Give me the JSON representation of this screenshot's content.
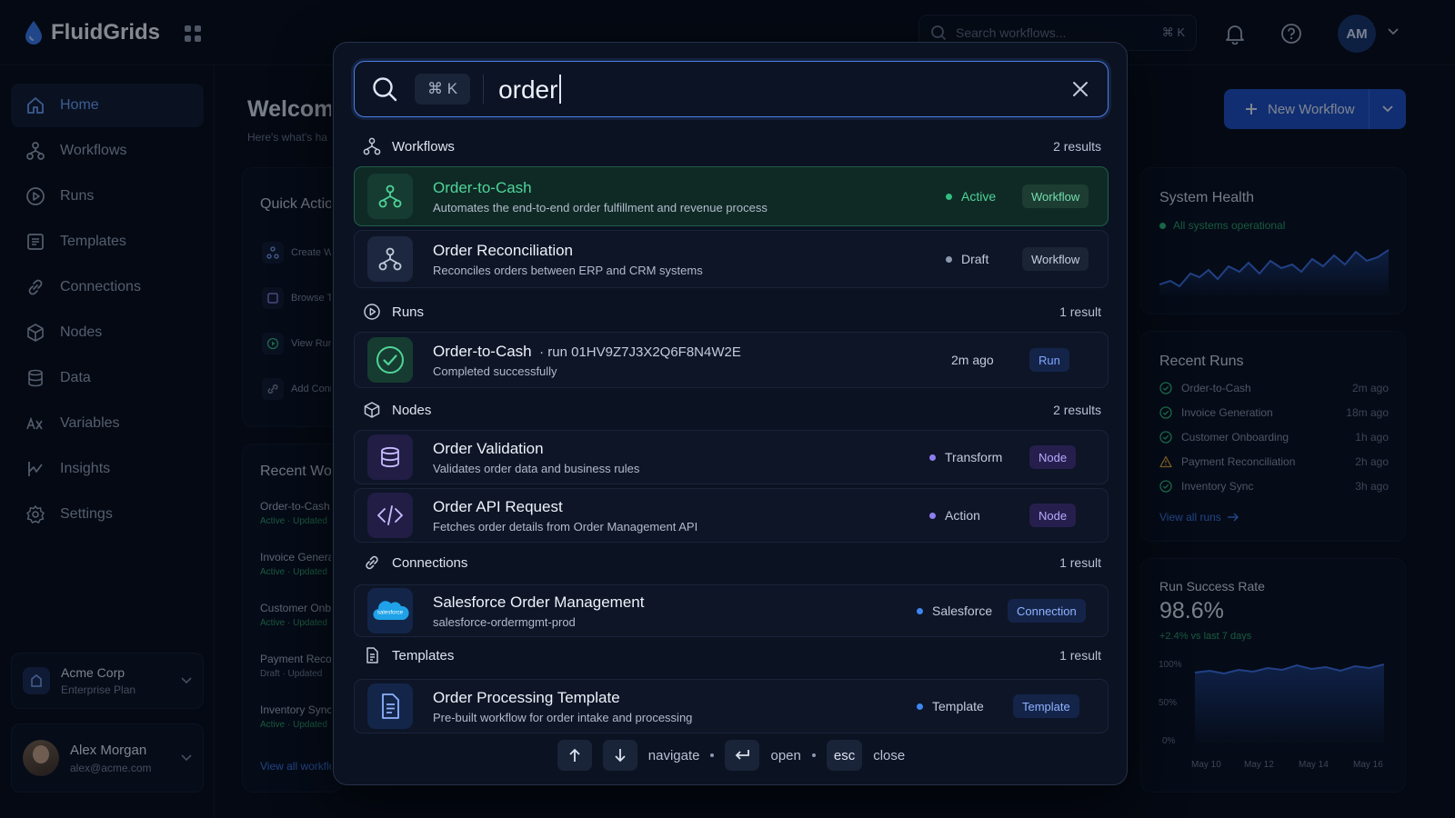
{
  "app": {
    "name": "FluidGrids"
  },
  "topbar": {
    "search_placeholder": "Search workflows...",
    "search_shortcut": "⌘ K",
    "avatar_initials": "AM"
  },
  "sidebar": {
    "items": [
      {
        "label": "Home",
        "icon": "home-icon",
        "active": true
      },
      {
        "label": "Workflows",
        "icon": "workflow-icon"
      },
      {
        "label": "Runs",
        "icon": "play-circle-icon"
      },
      {
        "label": "Templates",
        "icon": "template-icon"
      },
      {
        "label": "Connections",
        "icon": "link-icon"
      },
      {
        "label": "Nodes",
        "icon": "cube-icon"
      },
      {
        "label": "Data",
        "icon": "database-icon"
      },
      {
        "label": "Variables",
        "icon": "variable-icon"
      },
      {
        "label": "Insights",
        "icon": "insights-icon"
      },
      {
        "label": "Settings",
        "icon": "gear-icon"
      }
    ],
    "org": {
      "name": "Acme Corp",
      "plan": "Enterprise Plan"
    },
    "user": {
      "name": "Alex Morgan",
      "email": "alex@acme.com"
    }
  },
  "main": {
    "welcome": "Welcome",
    "welcome_sub": "Here's what's ha",
    "quick_actions": {
      "title": "Quick Actions",
      "items": [
        "Create Wo",
        "Browse Te",
        "View Runs",
        "Add Conn"
      ]
    },
    "recent_workflows": {
      "title": "Recent Wo",
      "items": [
        {
          "name": "Order-to-Cash",
          "meta": "Active · Updated"
        },
        {
          "name": "Invoice Generat",
          "meta": "Active · Updated"
        },
        {
          "name": "Customer Onbo",
          "meta": "Active · Updated"
        },
        {
          "name": "Payment Recon",
          "meta": "Draft · Updated"
        },
        {
          "name": "Inventory Sync",
          "meta": "Active · Updated"
        }
      ],
      "view_all": "View all workflows"
    },
    "new_workflow_label": "New Workflow"
  },
  "right_panel": {
    "system_health": {
      "title": "System Health",
      "status": "All systems operational"
    },
    "recent_runs": {
      "title": "Recent Runs",
      "items": [
        {
          "name": "Order-to-Cash",
          "time": "2m ago",
          "status": "success"
        },
        {
          "name": "Invoice Generation",
          "time": "18m ago",
          "status": "success"
        },
        {
          "name": "Customer Onboarding",
          "time": "1h ago",
          "status": "success"
        },
        {
          "name": "Payment Reconciliation",
          "time": "2h ago",
          "status": "warning"
        },
        {
          "name": "Inventory Sync",
          "time": "3h ago",
          "status": "success"
        }
      ],
      "view_all": "View all runs"
    },
    "run_success": {
      "title": "Run Success Rate",
      "value": "98.6%",
      "delta": "+2.4% vs last 7 days",
      "y_ticks": [
        "100%",
        "50%",
        "0%"
      ],
      "x_ticks": [
        "May 10",
        "May 12",
        "May 14",
        "May 16"
      ]
    }
  },
  "palette": {
    "shortcut": "⌘ K",
    "query": "order",
    "sections": {
      "workflows": {
        "label": "Workflows",
        "count": "2 results"
      },
      "runs": {
        "label": "Runs",
        "count": "1 result"
      },
      "nodes": {
        "label": "Nodes",
        "count": "2 results"
      },
      "connections": {
        "label": "Connections",
        "count": "1 result"
      },
      "templates": {
        "label": "Templates",
        "count": "1 result"
      }
    },
    "results": {
      "wf1": {
        "title": "Order-to-Cash",
        "desc": "Automates the end-to-end order fulfillment and revenue process",
        "status": "Active",
        "tag": "Workflow"
      },
      "wf2": {
        "title": "Order Reconciliation",
        "desc": "Reconciles orders between ERP and CRM systems",
        "status": "Draft",
        "tag": "Workflow"
      },
      "run1": {
        "title": "Order-to-Cash",
        "run_id": "· run 01HV9Z7J3X2Q6F8N4W2E",
        "desc": "Completed successfully",
        "time": "2m ago",
        "tag": "Run"
      },
      "node1": {
        "title": "Order Validation",
        "desc": "Validates order data and business rules",
        "status": "Transform",
        "tag": "Node"
      },
      "node2": {
        "title": "Order API Request",
        "desc": "Fetches order details from Order Management API",
        "status": "Action",
        "tag": "Node"
      },
      "conn1": {
        "title": "Salesforce Order Management",
        "desc": "salesforce-ordermgmt-prod",
        "status": "Salesforce",
        "tag": "Connection",
        "logo_text": "salesforce"
      },
      "tmpl1": {
        "title": "Order Processing Template",
        "desc": "Pre-built workflow for order intake and processing",
        "status": "Template",
        "tag": "Template"
      }
    },
    "footer": {
      "navigate": "navigate",
      "open": "open",
      "esc": "esc",
      "close": "close"
    }
  },
  "colors": {
    "accent": "#4d7fe8",
    "success": "#2fbf7f",
    "warning": "#e0a63a",
    "brand": "#1c4fc4"
  }
}
